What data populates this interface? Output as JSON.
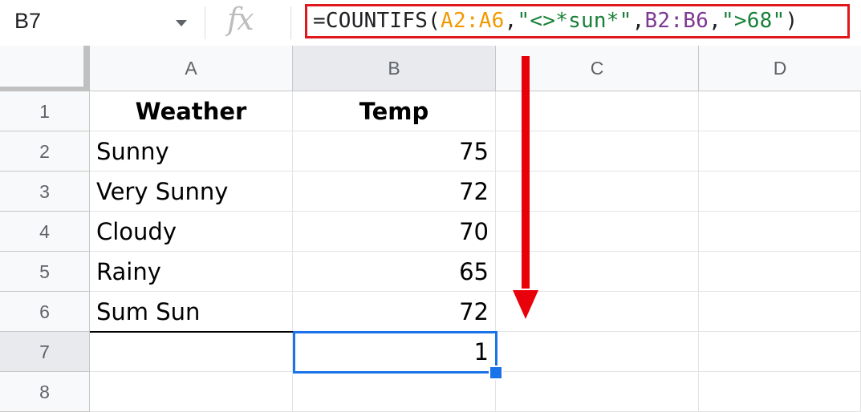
{
  "formula_bar": {
    "name_box": "B7",
    "fx_label": "fx",
    "formula": {
      "prefix": "=COUNTIFS(",
      "range1": "A2:A6",
      "comma1": ",",
      "criteria1": "\"<>*sun*\"",
      "comma2": ",",
      "range2": "B2:B6",
      "comma3": ",",
      "criteria2": "\">68\"",
      "suffix": ")"
    }
  },
  "columns": [
    "A",
    "B",
    "C",
    "D"
  ],
  "rows": [
    "1",
    "2",
    "3",
    "4",
    "5",
    "6",
    "7",
    "8"
  ],
  "cells": {
    "A1": "Weather",
    "B1": "Temp",
    "A2": "Sunny",
    "B2": "75",
    "A3": "Very Sunny",
    "B3": "72",
    "A4": "Cloudy",
    "B4": "70",
    "A5": "Rainy",
    "B5": "65",
    "A6": "Sum Sun",
    "B6": "72",
    "B7": "1"
  },
  "selected_cell": "B7",
  "colors": {
    "highlight_border": "#e0181c",
    "annotation_arrow": "#e8000b",
    "selection": "#1a73e8",
    "range1": "#f29900",
    "range2": "#7e3794",
    "string_literal": "#188038"
  }
}
